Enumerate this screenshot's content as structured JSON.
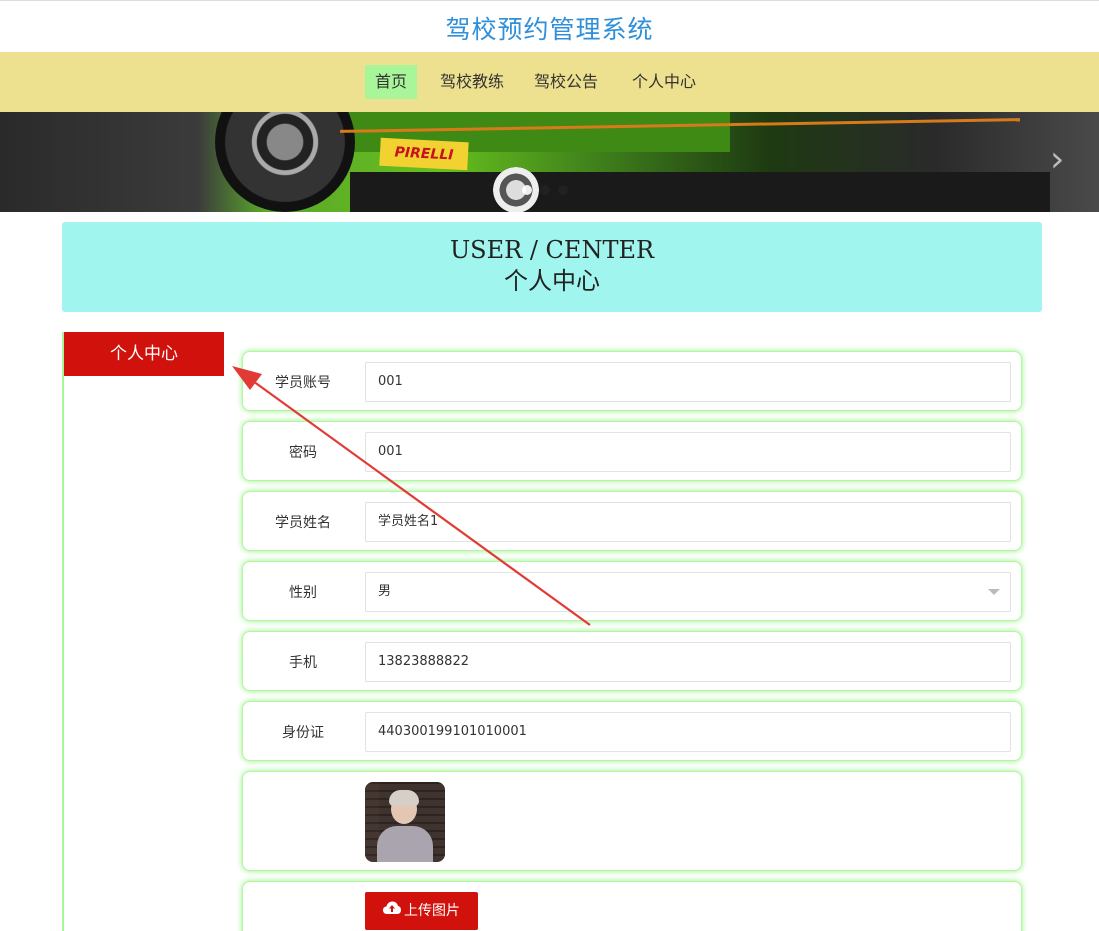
{
  "site": {
    "title": "驾校预约管理系统"
  },
  "nav": {
    "items": [
      {
        "label": "首页",
        "active": true
      },
      {
        "label": "驾校教练",
        "active": false
      },
      {
        "label": "驾校公告",
        "active": false
      },
      {
        "label": "个人中心",
        "active": false
      }
    ]
  },
  "banner": {
    "brand_text": "PIRELLI"
  },
  "center_head": {
    "en": "USER / CENTER",
    "zh": "个人中心"
  },
  "sidebar": {
    "tab_label": "个人中心"
  },
  "form": {
    "account": {
      "label": "学员账号",
      "value": "001"
    },
    "password": {
      "label": "密码",
      "value": "001"
    },
    "name": {
      "label": "学员姓名",
      "value": "学员姓名1"
    },
    "gender": {
      "label": "性别",
      "value": "男"
    },
    "phone": {
      "label": "手机",
      "value": "13823888822"
    },
    "id_card": {
      "label": "身份证",
      "value": "440300199101010001"
    },
    "upload_label": "上传图片"
  },
  "colors": {
    "accent_red": "#d0110c",
    "nav_bg": "#ede08f",
    "nav_active": "#a8f59a",
    "head_bg": "#a0f5ef",
    "title_blue": "#2f8fd8"
  },
  "icons": {
    "upload": "cloud-upload-icon",
    "select": "chevron-down-icon",
    "carousel_next": "chevron-right-icon"
  }
}
